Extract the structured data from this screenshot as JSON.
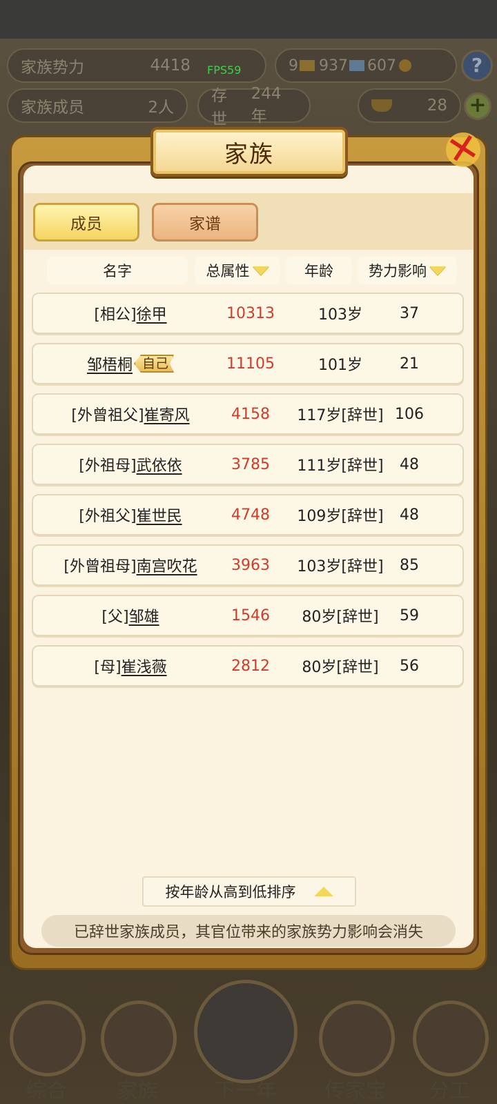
{
  "hud": {
    "clan_power_label": "家族势力",
    "clan_power_value": "4418",
    "fps": "FPS59",
    "gold": "9",
    "silver": "937",
    "coin": "607",
    "members_label": "家族成员",
    "members_value": "2人",
    "survived_label": "存世",
    "survived_value": "244年",
    "ingot_value": "28"
  },
  "dialog": {
    "title": "家族",
    "tabs": [
      {
        "label": "成员",
        "active": true
      },
      {
        "label": "家谱",
        "active": false
      }
    ],
    "headers": {
      "name": "名字",
      "total_attr": "总属性",
      "age": "年龄",
      "influence": "势力影响"
    },
    "rows": [
      {
        "prefix": "[相公]",
        "name": "徐甲",
        "attr": "10313",
        "age": "103岁",
        "influence": "37"
      },
      {
        "prefix": "",
        "name": "邹梧桐",
        "badge": "自己",
        "attr": "11105",
        "age": "101岁",
        "influence": "21"
      },
      {
        "prefix": "[外曾祖父]",
        "name": "崔寄风",
        "attr": "4158",
        "age": "117岁[辞世]",
        "influence": "106"
      },
      {
        "prefix": "[外祖母]",
        "name": "武依依",
        "attr": "3785",
        "age": "111岁[辞世]",
        "influence": "48"
      },
      {
        "prefix": "[外祖父]",
        "name": "崔世民",
        "attr": "4748",
        "age": "109岁[辞世]",
        "influence": "48"
      },
      {
        "prefix": "[外曾祖母]",
        "name": "南宫吹花",
        "attr": "3963",
        "age": "103岁[辞世]",
        "influence": "85"
      },
      {
        "prefix": "[父]",
        "name": "邹雄",
        "attr": "1546",
        "age": "80岁[辞世]",
        "influence": "59"
      },
      {
        "prefix": "[母]",
        "name": "崔浅薇",
        "attr": "2812",
        "age": "80岁[辞世]",
        "influence": "56"
      }
    ],
    "sort_label": "按年龄从高到低排序",
    "notice": "已辞世家族成员，其官位带来的家族势力影响会消失"
  },
  "nav": {
    "items": [
      {
        "label": "综合"
      },
      {
        "label": "家族"
      },
      {
        "label": "下一年"
      },
      {
        "label": "传家宝"
      },
      {
        "label": "分工"
      }
    ]
  },
  "colors": {
    "attr_red": "#d23a2a",
    "close_red": "#d6231f",
    "frame_gold": "#c89a3e"
  }
}
